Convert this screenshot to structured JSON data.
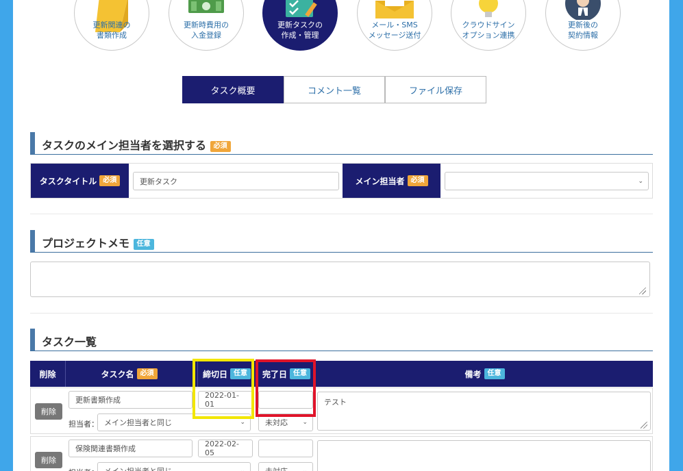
{
  "nav": [
    {
      "line1": "更新関連の",
      "line2": "書類作成",
      "icon": "document-icon"
    },
    {
      "line1": "更新時費用の",
      "line2": "入金登録",
      "icon": "money-icon"
    },
    {
      "line1": "更新タスクの",
      "line2": "作成・管理",
      "icon": "checklist-icon"
    },
    {
      "line1": "メール・SMS",
      "line2": "メッセージ送付",
      "icon": "envelope-icon"
    },
    {
      "line1": "クラウドサイン",
      "line2": "オプション連携",
      "icon": "lightbulb-icon"
    },
    {
      "line1": "更新後の",
      "line2": "契約情報",
      "icon": "person-icon"
    }
  ],
  "tabs": [
    "タスク概要",
    "コメント一覧",
    "ファイル保存"
  ],
  "badges": {
    "required": "必須",
    "optional": "任意"
  },
  "section_main": {
    "title": "タスクのメイン担当者を選択する"
  },
  "form": {
    "task_title_label": "タスクタイトル",
    "task_title_value": "更新タスク",
    "main_assignee_label": "メイン担当者",
    "main_assignee_value": ""
  },
  "section_memo": {
    "title": "プロジェクトメモ"
  },
  "section_tasks": {
    "title": "タスク一覧"
  },
  "table": {
    "headers": {
      "delete": "削除",
      "task_name": "タスク名",
      "due_date": "締切日",
      "done_date": "完了日",
      "note": "備考"
    },
    "delete_label": "削除",
    "assignee_label": "担当者：",
    "rows": [
      {
        "name": "更新書類作成",
        "due": "2022-01-01",
        "done": "",
        "assignee": "メイン担当者と同じ",
        "status": "未対応",
        "note": "テスト"
      },
      {
        "name": "保険関連書類作成",
        "due": "2022-02-05",
        "done": "",
        "assignee": "メイン担当者と同じ",
        "status": "未対応",
        "note": ""
      }
    ]
  },
  "colors": {
    "navy": "#1b1d70",
    "frame": "#3fa6ea",
    "required": "#f0a63a",
    "optional": "#4cb6dd"
  }
}
